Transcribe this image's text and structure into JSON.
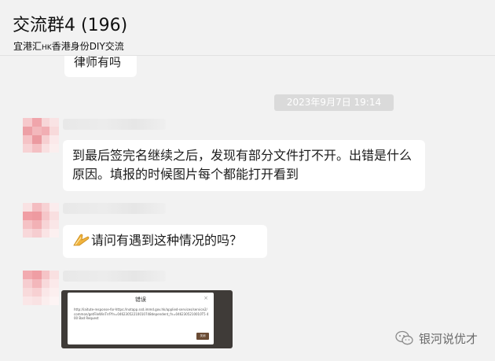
{
  "header": {
    "title": "交流群4 (196)",
    "subtitle_pre": "宜港汇",
    "subtitle_small": "HK",
    "subtitle_post": "香港身份DIY交流"
  },
  "messages": {
    "top_partial": "律师有吗",
    "timestamp": "2023年9月7日 19:14",
    "msg1": "到最后签完名继续之后，发现有部分文件打不开。出错是什么原因。填报的时候图片每个都能打开看到",
    "msg2_text": "请问有遇到这种情况的吗？"
  },
  "image_message": {
    "dialog_title": "错误",
    "dialog_close": "×",
    "dialog_body": "http://iaitute-response-for-https://notapp.ssd.immd.gov.hk/applied-services/service2/common/getFileWinTnf?fn=04623052210010748dependent_fn=0462305210010T5 400 Bad Request",
    "dialog_button": "关闭"
  },
  "watermark": {
    "text": "银河说优才",
    "icon": "wechat-official-account-icon"
  },
  "colors": {
    "background": "#f2f2f2",
    "bubble": "#ffffff",
    "timestamp_bg": "#dadada",
    "avatar_pink": "#f3a8ae"
  }
}
